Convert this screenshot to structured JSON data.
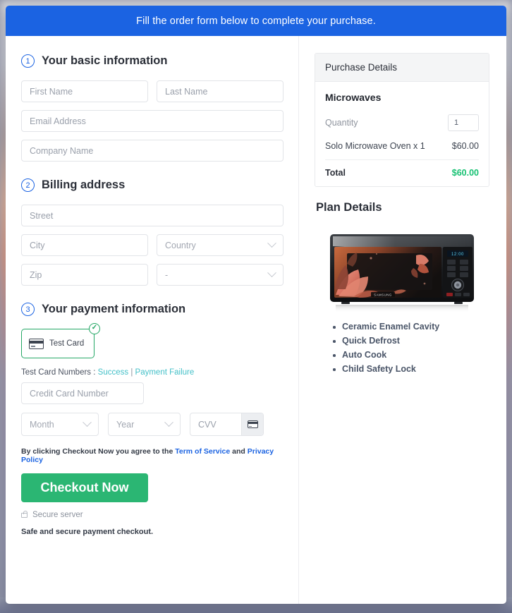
{
  "banner": {
    "message": "Fill the order form below to complete your purchase."
  },
  "sections": {
    "basic": {
      "number": "1",
      "title": "Your basic information",
      "fields": {
        "first_name": "First Name",
        "last_name": "Last Name",
        "email": "Email Address",
        "company": "Company Name"
      }
    },
    "billing": {
      "number": "2",
      "title": "Billing address",
      "fields": {
        "street": "Street",
        "city": "City",
        "country": "Country",
        "zip": "Zip",
        "state": "-"
      }
    },
    "payment": {
      "number": "3",
      "title": "Your payment information",
      "card_tile_label": "Test Card",
      "card_tile_selected": true,
      "test_numbers_label": "Test Card Numbers :",
      "test_numbers_success": "Success",
      "test_numbers_separator": "|",
      "test_numbers_failure": "Payment Failure",
      "credit_card_number": "Credit Card Number",
      "month": "Month",
      "year": "Year",
      "cvv": "CVV",
      "terms_prefix": "By clicking Checkout Now you agree to the",
      "terms_link": "Term of Service",
      "terms_and": "and",
      "privacy_link": "Privacy Policy",
      "checkout_label": "Checkout Now",
      "secure_server": "Secure server",
      "safe_note": "Safe and secure payment checkout."
    }
  },
  "purchase": {
    "header": "Purchase Details",
    "product_title": "Microwaves",
    "quantity_label": "Quantity",
    "quantity_value": "1",
    "line_item_label": "Solo Microwave Oven x 1",
    "line_item_price": "$60.00",
    "total_label": "Total",
    "total_price": "$60.00"
  },
  "plan": {
    "title": "Plan Details",
    "product_brand": "SAMSUNG",
    "display_text": "12:00",
    "features": [
      "Ceramic Enamel Cavity",
      "Quick Defrost",
      "Auto Cook",
      "Child Safety Lock"
    ]
  },
  "colors": {
    "banner_blue": "#1b63e2",
    "accent_green": "#2bb673",
    "total_green": "#16c172",
    "link_teal": "#44c0c8",
    "link_blue": "#1b63e2"
  }
}
